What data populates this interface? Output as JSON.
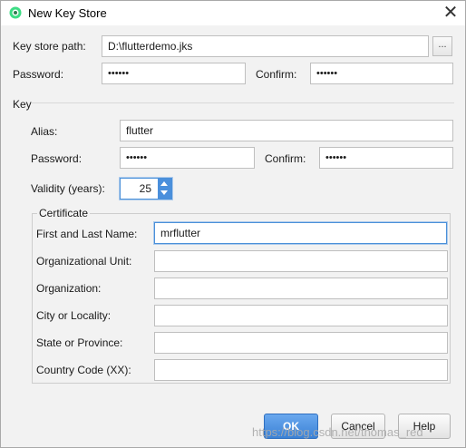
{
  "window": {
    "title": "New Key Store",
    "close_glyph": "✕"
  },
  "keystore": {
    "path_label": "Key store path:",
    "path_value": "D:\\flutterdemo.jks",
    "browse_label": "...",
    "password_label": "Password:",
    "password_value": "••••••",
    "confirm_label": "Confirm:",
    "confirm_value": "••••••"
  },
  "key": {
    "section_label": "Key",
    "alias_label": "Alias:",
    "alias_value": "flutter",
    "password_label": "Password:",
    "password_value": "••••••",
    "confirm_label": "Confirm:",
    "confirm_value": "••••••",
    "validity_label": "Validity (years):",
    "validity_value": "25"
  },
  "certificate": {
    "legend": "Certificate",
    "fields": [
      {
        "label": "First and Last Name:",
        "value": "mrflutter"
      },
      {
        "label": "Organizational Unit:",
        "value": ""
      },
      {
        "label": "Organization:",
        "value": ""
      },
      {
        "label": "City or Locality:",
        "value": ""
      },
      {
        "label": "State or Province:",
        "value": ""
      },
      {
        "label": "Country Code (XX):",
        "value": ""
      }
    ]
  },
  "buttons": {
    "ok": "OK",
    "cancel": "Cancel",
    "help": "Help"
  },
  "watermark": "https://blog.csdn.net/thomas_red",
  "colors": {
    "accent": "#3b82d6",
    "focus": "#4a90d9",
    "background": "#f2f2f2"
  },
  "icons": {
    "app": "android-studio-icon",
    "close": "close-icon",
    "spinner": "spinner-arrows-icon"
  }
}
